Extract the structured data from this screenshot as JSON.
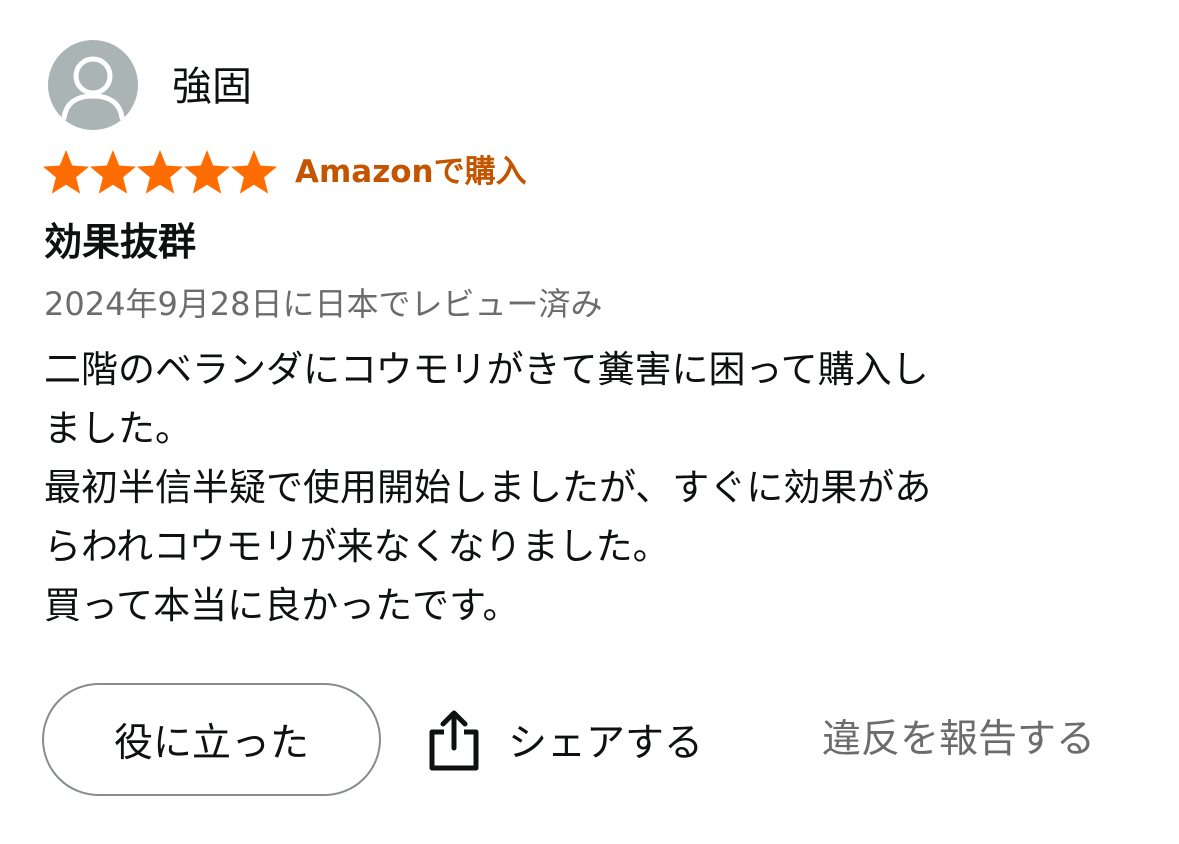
{
  "review": {
    "reviewer": {
      "name": "強固",
      "avatar_icon": "user-silhouette-icon"
    },
    "rating": {
      "value": 5,
      "max": 5,
      "star_color": "#ff6d00"
    },
    "verified_purchase_label": "Amazonで購入",
    "title": "効果抜群",
    "date_location": "2024年9月28日に日本でレビュー済み",
    "body_lines": [
      "二階のベランダにコウモリがきて糞害に困って購入し",
      "ました。",
      "最初半信半疑で使用開始しましたが、すぐに効果があ",
      "らわれコウモリが来なくなりました。",
      "買って本当に良かったです。"
    ]
  },
  "actions": {
    "helpful_label": "役に立った",
    "share_label": "シェアする",
    "share_icon": "share-icon",
    "report_label": "違反を報告する"
  },
  "colors": {
    "accent_orange": "#c45500",
    "star": "#ff6d00",
    "secondary_text": "#6c6c6c",
    "button_border": "#888c8c"
  }
}
